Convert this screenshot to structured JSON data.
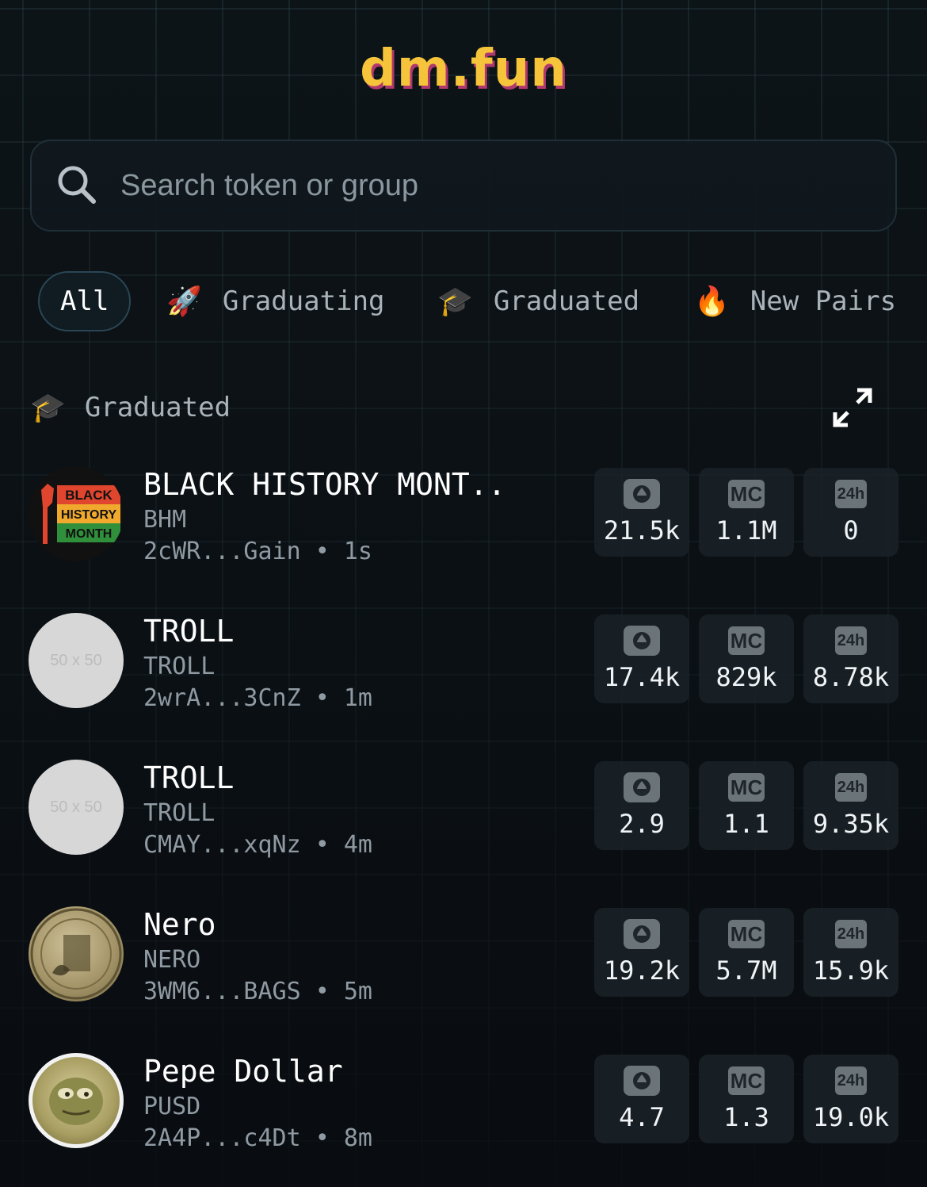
{
  "app": {
    "logo": "dm.fun"
  },
  "search": {
    "placeholder": "Search token or group"
  },
  "tabs": [
    {
      "label": "All",
      "icon": "",
      "active": true
    },
    {
      "label": "Graduating",
      "icon": "🚀"
    },
    {
      "label": "Graduated",
      "icon": "🎓"
    },
    {
      "label": "New Pairs",
      "icon": "🔥"
    }
  ],
  "section": {
    "icon": "🎓",
    "title": "Graduated"
  },
  "avatar_placeholder_text": "50 x 50",
  "stat_labels": {
    "mc": "MC",
    "h24": "24h"
  },
  "tokens": [
    {
      "name": "BLACK HISTORY MONT..",
      "ticker": "BHM",
      "address": "2cWR...Gain",
      "age": "1s",
      "liquidity": "21.5k",
      "mc": "1.1M",
      "vol24h": "0",
      "avatar": "bhm",
      "avatar_text": [
        "BLACK",
        "HISTORY",
        "MONTH"
      ]
    },
    {
      "name": "TROLL",
      "ticker": "TROLL",
      "address": "2wrA...3CnZ",
      "age": "1m",
      "liquidity": "17.4k",
      "mc": "829k",
      "vol24h": "8.78k",
      "avatar": "placeholder"
    },
    {
      "name": "TROLL",
      "ticker": "TROLL",
      "address": "CMAY...xqNz",
      "age": "4m",
      "liquidity": "2.9",
      "mc": "1.1",
      "vol24h": "9.35k",
      "avatar": "placeholder"
    },
    {
      "name": "Nero",
      "ticker": "NERO",
      "address": "3WM6...BAGS",
      "age": "5m",
      "liquidity": "19.2k",
      "mc": "5.7M",
      "vol24h": "15.9k",
      "avatar": "coin"
    },
    {
      "name": "Pepe Dollar",
      "ticker": "PUSD",
      "address": "2A4P...c4Dt",
      "age": "8m",
      "liquidity": "4.7",
      "mc": "1.3",
      "vol24h": "19.0k",
      "avatar": "pepe"
    }
  ]
}
